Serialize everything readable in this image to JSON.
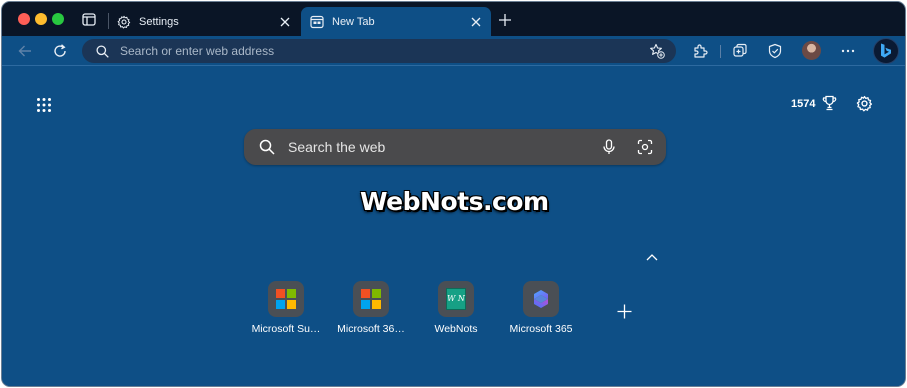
{
  "tabs": [
    {
      "title": "Settings",
      "icon": "gear-icon",
      "active": false
    },
    {
      "title": "New Tab",
      "icon": "new-tab-page-icon",
      "active": true
    }
  ],
  "address_bar": {
    "placeholder": "Search or enter web address"
  },
  "rewards": {
    "points": "1574"
  },
  "search": {
    "placeholder": "Search the web"
  },
  "watermark": "WebNots.com",
  "quick_links": [
    {
      "label": "Microsoft Su…",
      "icon": "microsoft-logo-icon"
    },
    {
      "label": "Microsoft 36…",
      "icon": "microsoft-logo-icon"
    },
    {
      "label": "WebNots",
      "icon": "webnots-logo-icon",
      "logo_text": "W N"
    },
    {
      "label": "Microsoft 365",
      "icon": "microsoft-365-icon"
    }
  ],
  "colors": {
    "frame": "#0a1526",
    "page_background": "#0e4f86",
    "searchbox": "#4a4a4c",
    "ms_red": "#f25022",
    "ms_green": "#7fba00",
    "ms_blue": "#00a4ef",
    "ms_yellow": "#ffb900"
  }
}
